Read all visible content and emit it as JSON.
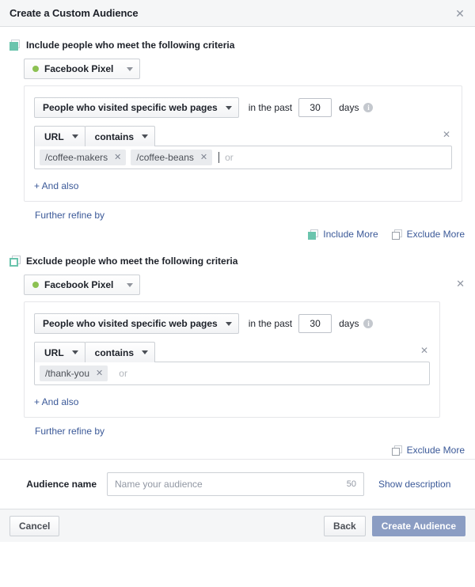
{
  "dialog": {
    "title": "Create a Custom Audience",
    "close_icon": "close-icon"
  },
  "include_section": {
    "heading": "Include people who meet the following criteria",
    "icon": "include-squares-icon",
    "source": {
      "name": "Facebook Pixel",
      "dot_color": "#8cc152",
      "caret_icon": "chevron-down-icon"
    },
    "rule": {
      "event": "People who visited specific web pages",
      "in_the_past": "in the past",
      "days_value": "30",
      "days_label": "days",
      "info_icon": "info-icon",
      "filter_field": "URL",
      "filter_operator": "contains",
      "tokens": [
        "/coffee-makers",
        "/coffee-beans"
      ],
      "input_placeholder": "or",
      "remove_icon": "close-icon"
    },
    "and_also": "+ And also",
    "further_refine": "Further refine by"
  },
  "more_actions_top": {
    "include_more": "Include More",
    "exclude_more": "Exclude More",
    "include_icon": "include-squares-icon",
    "exclude_icon": "exclude-squares-icon"
  },
  "exclude_section": {
    "heading": "Exclude people who meet the following criteria",
    "icon": "exclude-squares-icon",
    "source": {
      "name": "Facebook Pixel",
      "dot_color": "#8cc152",
      "caret_icon": "chevron-down-icon"
    },
    "remove_icon": "close-icon",
    "rule": {
      "event": "People who visited specific web pages",
      "in_the_past": "in the past",
      "days_value": "30",
      "days_label": "days",
      "info_icon": "info-icon",
      "filter_field": "URL",
      "filter_operator": "contains",
      "tokens": [
        "/thank-you"
      ],
      "input_placeholder": "or",
      "remove_icon": "close-icon"
    },
    "and_also": "+ And also",
    "further_refine": "Further refine by"
  },
  "more_actions_bottom": {
    "exclude_more": "Exclude More",
    "exclude_icon": "exclude-squares-icon"
  },
  "audience_name": {
    "label": "Audience name",
    "value": "",
    "placeholder": "Name your audience",
    "char_limit": "50",
    "show_description": "Show description"
  },
  "footer": {
    "cancel": "Cancel",
    "back": "Back",
    "create": "Create Audience",
    "primary_color": "#8b9dc3"
  }
}
